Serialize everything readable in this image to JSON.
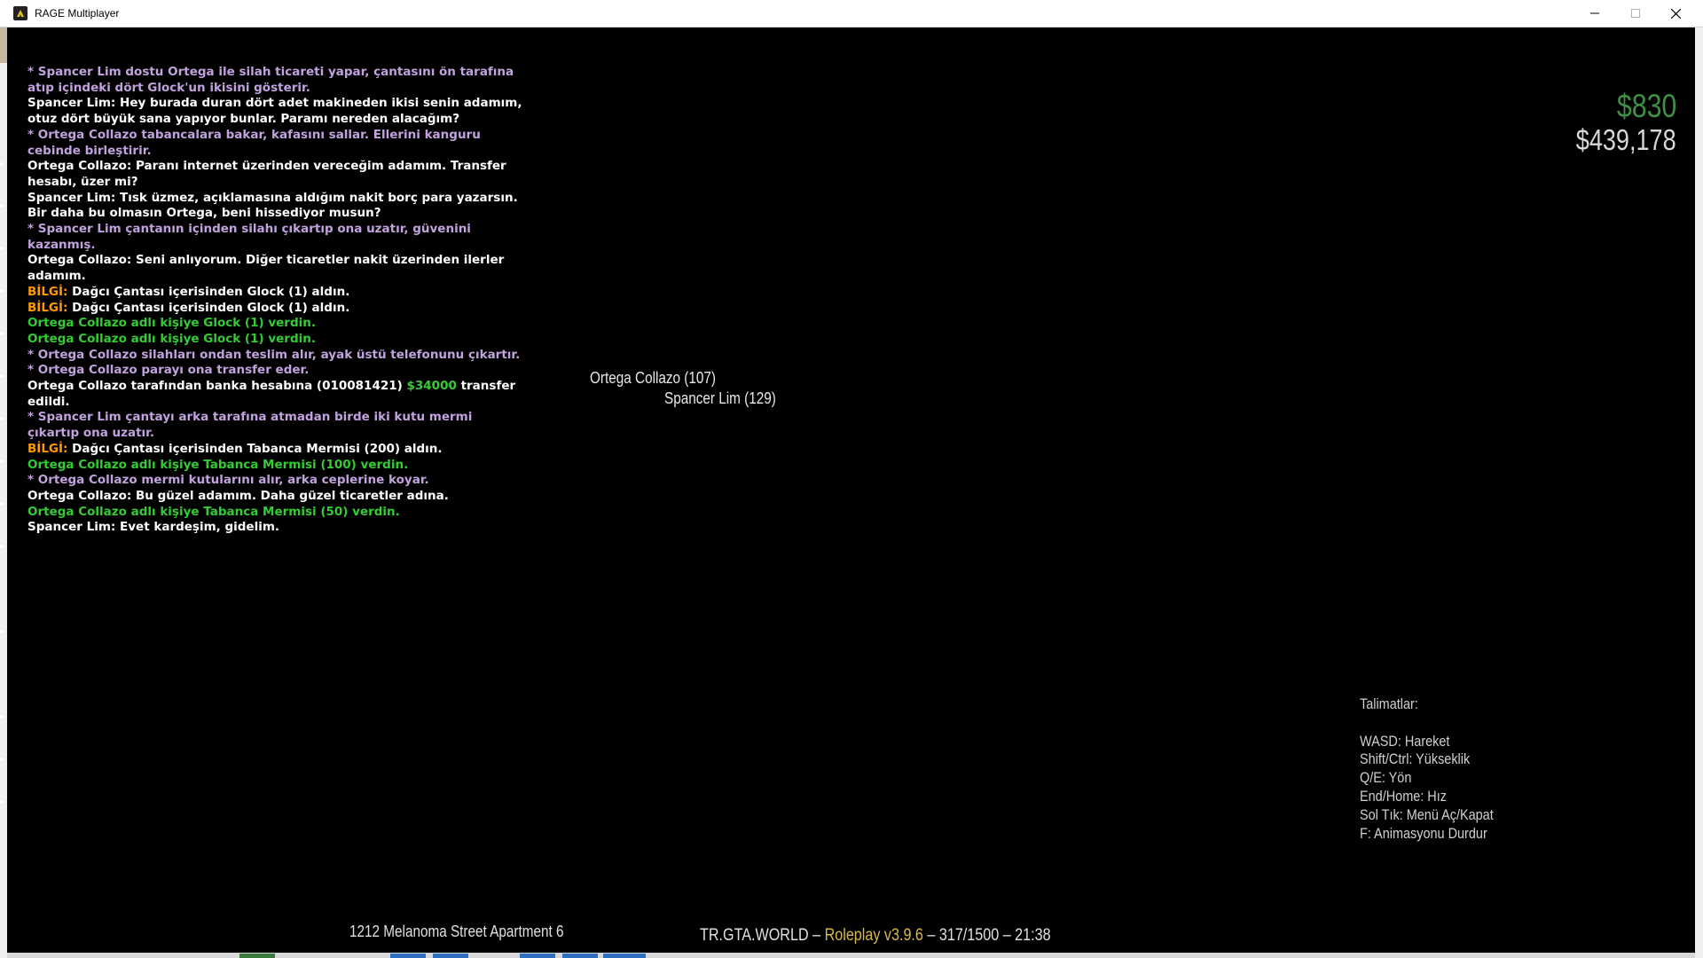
{
  "window": {
    "title": "RAGE Multiplayer",
    "icon": "rage-mp-icon",
    "controls": [
      "minimize-icon",
      "maximize-icon",
      "close-icon"
    ]
  },
  "colors": {
    "action": "#c2a2de",
    "say": "#ffffff",
    "give": "#33cc33",
    "info_tag": "#ff9900",
    "cash": "#3f8f46",
    "bank": "#d8d8d8",
    "version": "#d9b94a"
  },
  "chat": [
    {
      "type": "action",
      "text": "* Spancer Lim dostu Ortega ile silah ticareti yapar, çantasını ön tarafına atıp içindeki dört Glock'un ikisini gösterir."
    },
    {
      "type": "say",
      "text": "Spancer Lim: Hey burada duran dört adet makineden ikisi senin adamım, otuz dört büyük sana yapıyor bunlar. Paramı nereden alacağım?"
    },
    {
      "type": "action",
      "text": "* Ortega Collazo tabancalara bakar, kafasını sallar. Ellerini kanguru cebinde birleştirir."
    },
    {
      "type": "say",
      "text": "Ortega Collazo: Paranı internet üzerinden vereceğim adamım. Transfer hesabı, üzer mi?"
    },
    {
      "type": "say",
      "text": "Spancer Lim: Tısk üzmez, açıklamasına aldığım nakit borç para yazarsın. Bir daha bu olmasın Ortega, beni hissediyor musun?"
    },
    {
      "type": "action",
      "text": "* Spancer Lim çantanın içinden silahı çıkartıp ona uzatır, güvenini kazanmış."
    },
    {
      "type": "say",
      "text": "Ortega Collazo: Seni anlıyorum. Diğer ticaretler nakit üzerinden ilerler adamım."
    },
    {
      "type": "info",
      "tag": "BİLGİ:",
      "text": " Dağcı Çantası içerisinden Glock (1) aldın."
    },
    {
      "type": "info",
      "tag": "BİLGİ:",
      "text": " Dağcı Çantası içerisinden Glock (1) aldın."
    },
    {
      "type": "give",
      "text": "Ortega Collazo adlı kişiye Glock (1) verdin."
    },
    {
      "type": "give",
      "text": "Ortega Collazo adlı kişiye Glock (1) verdin."
    },
    {
      "type": "action",
      "text": "* Ortega Collazo silahları ondan teslim alır, ayak üstü telefonunu çıkartır."
    },
    {
      "type": "action",
      "text": "* Ortega Collazo parayı ona transfer eder."
    },
    {
      "type": "transfer",
      "before": "Ortega Collazo tarafından banka hesabına (010081421) ",
      "amount": "$34000",
      "after": " transfer edildi."
    },
    {
      "type": "action",
      "text": "* Spancer Lim çantayı arka tarafına atmadan birde iki kutu mermi çıkartıp ona uzatır."
    },
    {
      "type": "info",
      "tag": "BİLGİ:",
      "text": " Dağcı Çantası içerisinden Tabanca Mermisi (200) aldın."
    },
    {
      "type": "give",
      "text": "Ortega Collazo adlı kişiye Tabanca Mermisi (100) verdin."
    },
    {
      "type": "action",
      "text": "* Ortega Collazo mermi kutularını alır, arka ceplerine koyar."
    },
    {
      "type": "say",
      "text": "Ortega Collazo: Bu güzel adamım. Daha güzel ticaretler adına."
    },
    {
      "type": "give",
      "text": "Ortega Collazo adlı kişiye Tabanca Mermisi (50) verdin."
    },
    {
      "type": "say",
      "text": "Spancer Lim: Evet kardeşim, gidelim."
    }
  ],
  "hud": {
    "cash": "$830",
    "bank": "$439,178"
  },
  "nametags": {
    "ortega": "Ortega Collazo (107)",
    "spancer": "Spancer Lim (129)"
  },
  "instructions": {
    "title": "Talimatlar:",
    "items": [
      "WASD: Hareket",
      "Shift/Ctrl: Yükseklik",
      "Q/E: Yön",
      "End/Home: Hız",
      "Sol Tık: Menü Aç/Kapat",
      "F: Animasyonu Durdur"
    ]
  },
  "location": "1212 Melanoma Street Apartment 6",
  "server": {
    "name": "TR.GTA.WORLD",
    "sep1": " – ",
    "version": "Roleplay v3.9.6",
    "sep2": " – ",
    "players": "317/1500",
    "sep3": " – ",
    "time": "21:38"
  }
}
